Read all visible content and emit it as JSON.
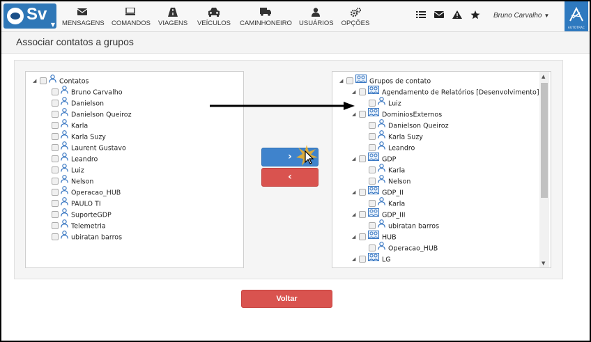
{
  "logo": {
    "text": "Sv"
  },
  "nav": [
    {
      "label": "MENSAGENS",
      "icon": "envelope-icon"
    },
    {
      "label": "COMANDOS",
      "icon": "monitor-icon"
    },
    {
      "label": "VIAGENS",
      "icon": "road-icon"
    },
    {
      "label": "VEÍCULOS",
      "icon": "car-icon"
    },
    {
      "label": "CAMINHONEIRO",
      "icon": "truck-icon"
    },
    {
      "label": "USUÁRIOS",
      "icon": "user-icon"
    },
    {
      "label": "OPÇÕES",
      "icon": "gears-icon"
    }
  ],
  "toolbar_icons": [
    "list-icon",
    "envelope-icon",
    "warning-icon",
    "star-icon"
  ],
  "user": {
    "name": "Bruno Carvalho"
  },
  "brand": {
    "label": "AUTOTRAC"
  },
  "page": {
    "title": "Associar contatos a grupos"
  },
  "contacts": {
    "root": "Contatos",
    "items": [
      "Bruno Carvalho",
      "Danielson",
      "Danielson Queiroz",
      "Karla",
      "Karla Suzy",
      "Laurent Gustavo",
      "Leandro",
      "Luiz",
      "Nelson",
      "Operacao_HUB",
      "PAULO TI",
      "SuporteGDP",
      "Telemetria",
      "ubiratan barros"
    ]
  },
  "groups": {
    "root": "Grupos de contato",
    "rows": [
      {
        "label": "Agendamento de Relatórios [Desenvolvimento]",
        "type": "group"
      },
      {
        "label": "Luiz",
        "type": "contact"
      },
      {
        "label": "DominiosExternos",
        "type": "group"
      },
      {
        "label": "Danielson Queiroz",
        "type": "contact"
      },
      {
        "label": "Karla Suzy",
        "type": "contact"
      },
      {
        "label": "Leandro",
        "type": "contact"
      },
      {
        "label": "GDP",
        "type": "group"
      },
      {
        "label": "Karla",
        "type": "contact"
      },
      {
        "label": "Nelson",
        "type": "contact"
      },
      {
        "label": "GDP_II",
        "type": "group"
      },
      {
        "label": "Karla",
        "type": "contact"
      },
      {
        "label": "GDP_III",
        "type": "group"
      },
      {
        "label": "ubiratan barros",
        "type": "contact"
      },
      {
        "label": "HUB",
        "type": "group"
      },
      {
        "label": "Operacao_HUB",
        "type": "contact"
      },
      {
        "label": "LG",
        "type": "group"
      }
    ]
  },
  "buttons": {
    "move_right": "›",
    "move_left": "‹",
    "back": "Voltar"
  },
  "colors": {
    "primary": "#3f83cc",
    "danger": "#d9534f",
    "brand": "#2e79bf"
  }
}
